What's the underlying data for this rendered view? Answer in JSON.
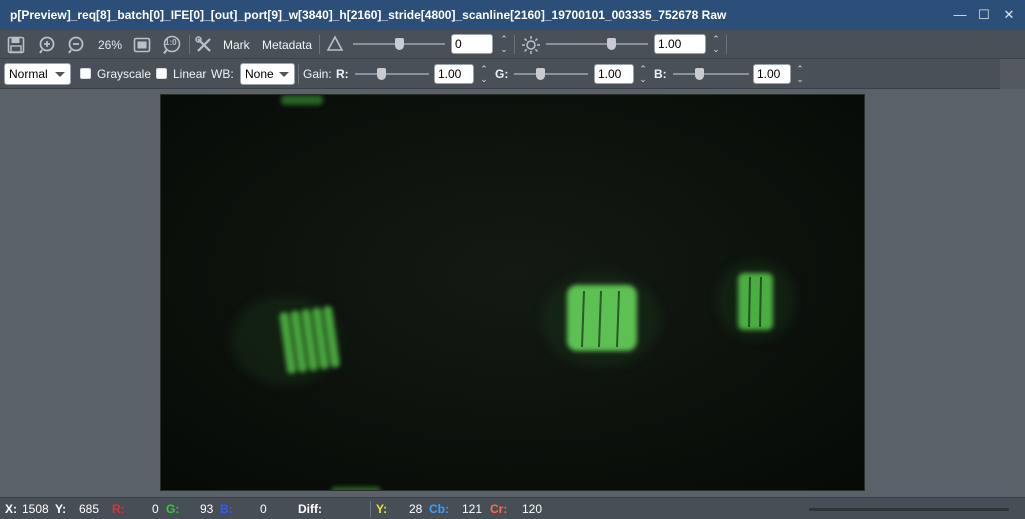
{
  "window": {
    "title": "p[Preview]_req[8]_batch[0]_IFE[0]_[out]_port[9]_w[3840]_h[2160]_stride[4800]_scanline[2160]_19700101_003335_752678 Raw",
    "minimize_glyph": "—",
    "maximize_glyph": "☐",
    "close_glyph": "✕"
  },
  "toolbar": {
    "zoom": "26%",
    "one_to_one_label": "1:0",
    "mark_label": "Mark",
    "metadata_label": "Metadata",
    "delta_value": "0",
    "brightness_value": "1.00",
    "delta_slider_level": 0.5,
    "brightness_slider_level": 0.5
  },
  "toolbar2": {
    "mode_select": "Normal",
    "grayscale_label": "Grayscale",
    "linear_label": "Linear",
    "wb_label": "WB:",
    "wb_select": "None",
    "gain_label": "Gain:",
    "r_label": "R:",
    "r_value": "1.00",
    "g_label": "G:",
    "g_value": "1.00",
    "b_label": "B:",
    "b_value": "1.00"
  },
  "status": {
    "x_label": "X:",
    "x_value": "1508",
    "y_label": "Y:",
    "y_value": "685",
    "r_label": "R:",
    "r_value": "0",
    "g_label": "G:",
    "g_value": "93",
    "b_label": "B:",
    "b_value": "0",
    "diff_label": "Diff:",
    "yy_label": "Y:",
    "yy_value": "28",
    "cb_label": "Cb:",
    "cb_value": "121",
    "cr_label": "Cr:",
    "cr_value": "120"
  },
  "colors": {
    "title_bar": "#2b4f79",
    "r": "#e03030",
    "g": "#2fcf2f",
    "b": "#2a5cff",
    "y": "#f0e040",
    "cb": "#3aa0ff",
    "cr": "#ff6a4a",
    "image_green": "#5fcb52"
  },
  "icons": [
    "save-icon",
    "zoom-in-icon",
    "zoom-out-icon",
    "fit-icon",
    "one-to-one-icon",
    "tools-icon",
    "delta-icon",
    "brightness-icon"
  ]
}
